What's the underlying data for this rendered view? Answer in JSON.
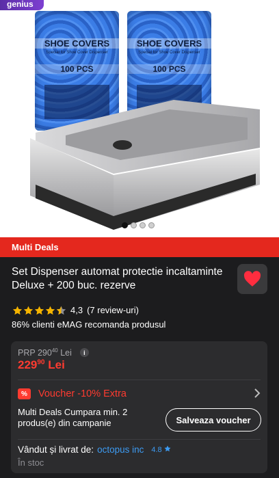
{
  "badge": {
    "genius": "genius"
  },
  "gallery": {
    "packs": [
      {
        "title": "SHOE COVERS",
        "subtitle": "Special for Shoe Cover Dispenser",
        "count": "100 PCS"
      },
      {
        "title": "SHOE COVERS",
        "subtitle": "Special for Shoe Cover Dispenser",
        "count": "100 PCS"
      }
    ],
    "dots_total": 4,
    "active_dot": 0
  },
  "deal": {
    "label": "Multi Deals"
  },
  "product": {
    "title": "Set Dispenser automat protectie incaltaminte Deluxe + 200 buc. rezerve",
    "rating_value": "4,3",
    "rating_stars": 4.3,
    "reviews": "(7 review-uri)",
    "recommend": "86% clienti eMAG recomanda produsul"
  },
  "price": {
    "prp_label": "PRP",
    "prp_int": "290",
    "prp_dec": "40",
    "prp_currency": "Lei",
    "current_int": "229",
    "current_dec": "90",
    "current_currency": "Lei"
  },
  "voucher": {
    "badge": "%",
    "label": "Voucher -10% Extra",
    "description": "Multi Deals Cumpara min. 2 produs(e) din campanie",
    "button": "Salveaza voucher"
  },
  "seller": {
    "label": "Vândut și livrat de:",
    "name": "octopus inc",
    "score": "4.8",
    "stock": "În stoc"
  },
  "colors": {
    "accent": "#e4281e",
    "price": "#ff3b30",
    "link": "#3d9bf2",
    "star": "#f5b400"
  },
  "icons": {
    "favorite": "heart-icon",
    "info": "info-icon",
    "chevron": "chevron-right-icon",
    "star": "star-icon"
  }
}
